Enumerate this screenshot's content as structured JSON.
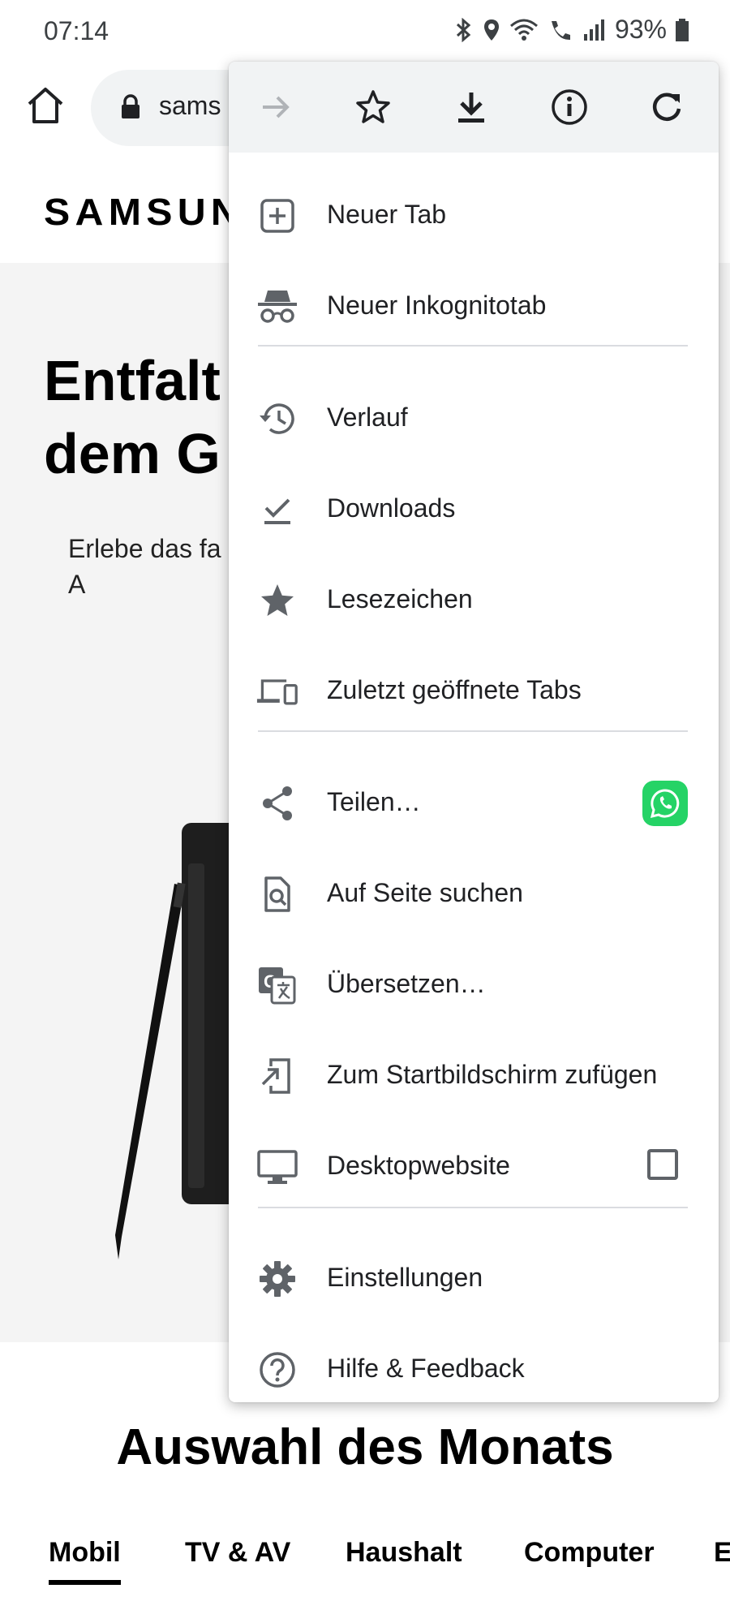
{
  "status_bar": {
    "time": "07:14",
    "battery": "93%"
  },
  "toolbar": {
    "url_text": "sams"
  },
  "page": {
    "logo": "SAMSUNG",
    "hero_title": "Entfalt\ndem G",
    "hero_subtitle": "Erlebe das fa\nA",
    "section_title": "Auswahl des Monats",
    "category_tabs": [
      "Mobil",
      "TV & AV",
      "Haushalt",
      "Computer",
      "E"
    ]
  },
  "menu": {
    "top_actions": [
      "forward-icon",
      "bookmark-star-icon",
      "download-icon",
      "info-icon",
      "reload-icon"
    ],
    "items": [
      {
        "label": "Neuer Tab",
        "icon": "new-tab-icon"
      },
      {
        "label": "Neuer Inkognitotab",
        "icon": "incognito-icon"
      },
      {
        "label": "Verlauf",
        "icon": "history-icon"
      },
      {
        "label": "Downloads",
        "icon": "downloads-icon"
      },
      {
        "label": "Lesezeichen",
        "icon": "star-icon"
      },
      {
        "label": "Zuletzt geöffnete Tabs",
        "icon": "devices-icon"
      },
      {
        "label": "Teilen…",
        "icon": "share-icon"
      },
      {
        "label": "Auf Seite suchen",
        "icon": "find-in-page-icon"
      },
      {
        "label": "Übersetzen…",
        "icon": "translate-icon"
      },
      {
        "label": "Zum Startbildschirm zufügen",
        "icon": "add-to-home-icon"
      },
      {
        "label": "Desktopwebsite",
        "icon": "desktop-icon",
        "checked": false
      },
      {
        "label": "Einstellungen",
        "icon": "settings-icon"
      },
      {
        "label": "Hilfe & Feedback",
        "icon": "help-icon"
      }
    ]
  },
  "colors": {
    "accent_whatsapp": "#25d366",
    "icon_gray": "#5f6368",
    "menu_top_bg": "#f1f3f4"
  }
}
